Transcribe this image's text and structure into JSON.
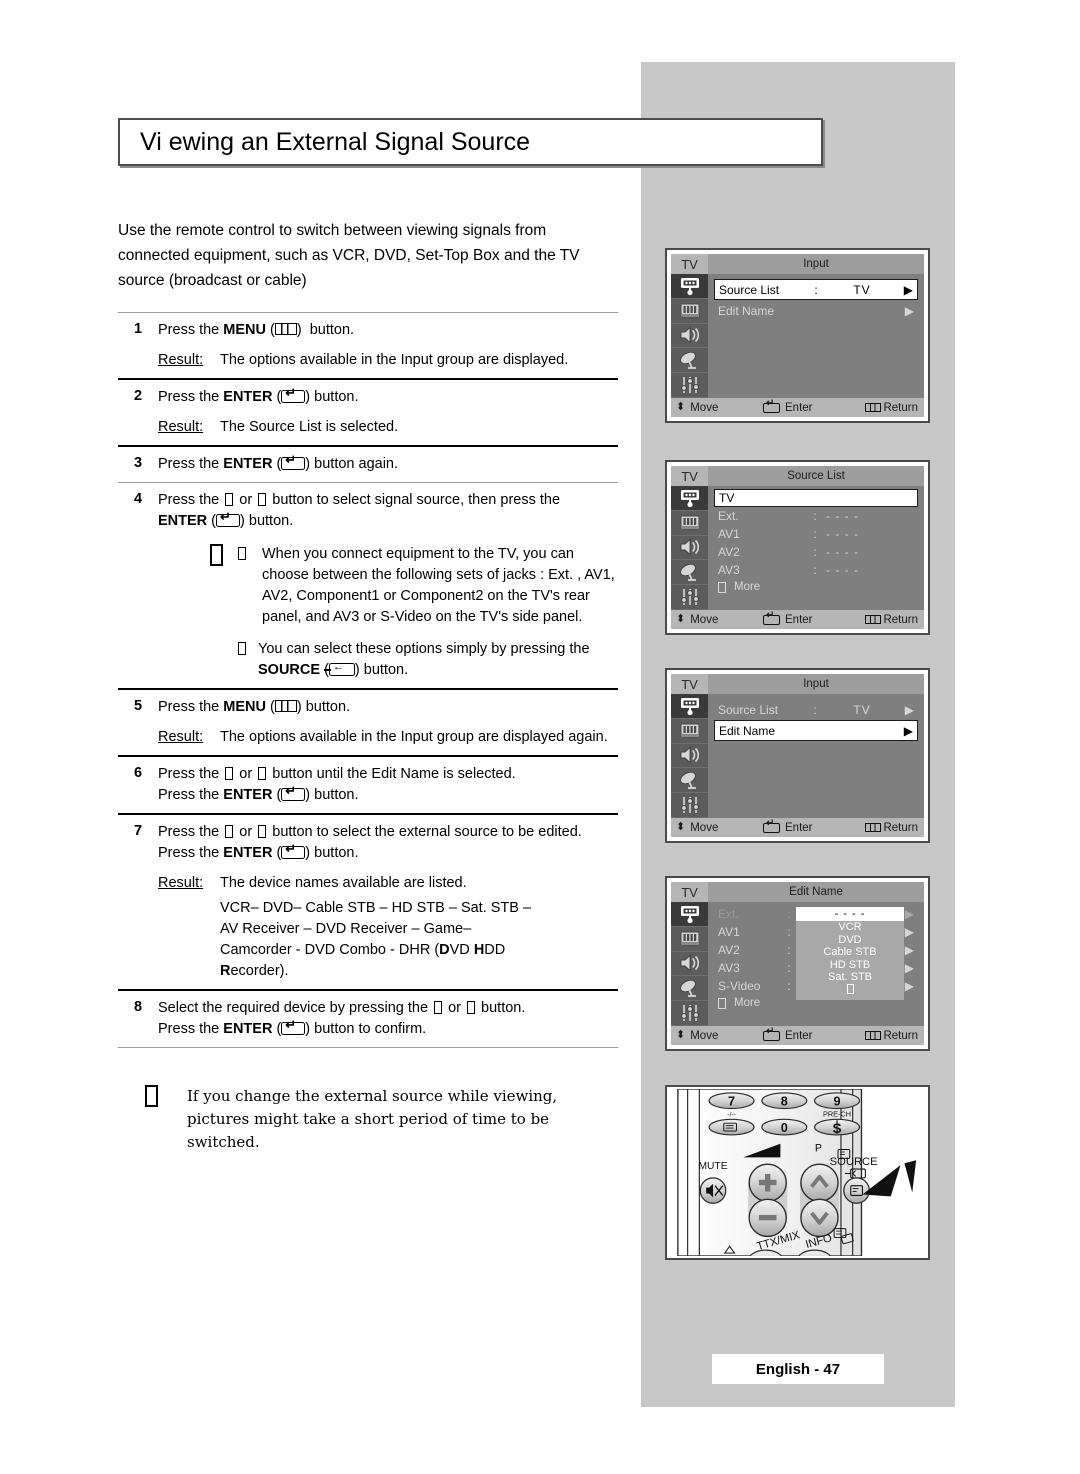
{
  "page": {
    "title": "Vi ewing an External Signal Source",
    "intro": "Use the remote control to switch between viewing signals from connected equipment, such as VCR, DVD, Set-Top Box and the TV source (broadcast or cable)",
    "footer": "English - 47"
  },
  "steps": [
    {
      "num": "1",
      "text_pre": "Press the ",
      "bold": "MENU",
      "icon": "menu-key-icon",
      "text_post": " button.",
      "result_label": "Result:",
      "result_text": "The options available in the Input   group are displayed."
    },
    {
      "num": "2",
      "text_pre": "Press the ",
      "bold": "ENTER",
      "icon": "enter-key-icon",
      "text_post": " button.",
      "result_label": "Result:",
      "result_text": "The Source List   is selected."
    },
    {
      "num": "3",
      "text_pre": "Press the ",
      "bold": "ENTER",
      "icon": "enter-key-icon",
      "text_post": " button again."
    },
    {
      "num": "4",
      "line1_a": "Press the ",
      "line1_b": " or ",
      "line1_c": " button to select signal source, then press the",
      "bold": "ENTER",
      "icon": "enter-key-icon",
      "line2_post": " button.",
      "notes": [
        "When you connect equipment to the TV, you can choose between the following sets of jacks :  Ext.  , AV1, AV2, Component1  or Component2  on the TV's rear panel, and AV3 or S-Video   on the TV's side panel.",
        "You can select these options simply by pressing the "
      ],
      "note2_bold": "SOURCE",
      "note2_icon": "source-key-icon",
      "note2_post": " button."
    },
    {
      "num": "5",
      "text_pre": "Press the ",
      "bold": "MENU",
      "icon": "menu-key-icon",
      "text_post": " button.",
      "result_label": "Result:",
      "result_text": "The options available in the Input   group are displayed again."
    },
    {
      "num": "6",
      "line1_a": "Press the ",
      "line1_b": " or ",
      "line1_c": " button until the Edit Name   is selected.",
      "line2_pre": "Press the ",
      "bold": "ENTER",
      "icon": "enter-key-icon",
      "line2_post": " button."
    },
    {
      "num": "7",
      "line1_a": "Press the ",
      "line1_b": " or ",
      "line1_c": " button to select the external source to be edited.",
      "line2_pre": "Press the ",
      "bold": "ENTER",
      "icon": "enter-key-icon",
      "line2_post": " button.",
      "result_label": "Result:",
      "result_text": "The device names available are listed.",
      "device_lines": [
        "VCR–  DVD– Cable STB   – HD STB –  Sat. STB     –",
        "AV Receiver     – DVD Receiver      – Game–",
        "Camcorder - DVD Combo - DHR        ("
      ],
      "device_bold_1": "D",
      "device_mid_1": "VD ",
      "device_bold_2": "H",
      "device_mid_2": "DD",
      "device_bold_3": "R",
      "device_tail": "ecorder)."
    },
    {
      "num": "8",
      "line1_a": "Select the required device by pressing the ",
      "line1_b": " or ",
      "line1_c": " button.",
      "line2_pre": "Press the ",
      "bold": "ENTER",
      "icon": "enter-key-icon",
      "line2_post": " button to confirm."
    }
  ],
  "bottom_note": "If you change the external source while viewing, pictures might take a short period of time to be switched.",
  "osd": {
    "footer": {
      "move": "Move",
      "enter": "Enter",
      "return": "Return"
    },
    "screens": [
      {
        "name": "input-menu-source-list-highlighted",
        "tv": "TV",
        "title": "Input",
        "rows": [
          {
            "label": "Source List",
            "colon": ":",
            "value": "TV",
            "arrow": "▶",
            "highlight": true
          },
          {
            "label": "Edit Name",
            "colon": "",
            "value": "",
            "arrow": "▶",
            "highlight": false
          }
        ]
      },
      {
        "name": "source-list-menu",
        "tv": "TV",
        "title": "Source List",
        "rows": [
          {
            "label": "TV",
            "colon": "",
            "value": "",
            "arrow": "",
            "highlight": true
          },
          {
            "label": "Ext.",
            "colon": ":",
            "value": "- - - -",
            "arrow": "",
            "highlight": false
          },
          {
            "label": "AV1",
            "colon": ":",
            "value": "- - - -",
            "arrow": "",
            "highlight": false
          },
          {
            "label": "AV2",
            "colon": ":",
            "value": "- - - -",
            "arrow": "",
            "highlight": false
          },
          {
            "label": "AV3",
            "colon": ":",
            "value": "- - - -",
            "arrow": "",
            "highlight": false
          }
        ],
        "more": "More"
      },
      {
        "name": "input-menu-edit-name-highlighted",
        "tv": "TV",
        "title": "Input",
        "rows": [
          {
            "label": "Source List",
            "colon": ":",
            "value": "TV",
            "arrow": "▶",
            "highlight": false
          },
          {
            "label": "Edit Name",
            "colon": "",
            "value": "",
            "arrow": "▶",
            "highlight": true
          }
        ]
      },
      {
        "name": "edit-name-menu",
        "tv": "TV",
        "title": "Edit Name",
        "rows": [
          {
            "label": "Ext.",
            "colon": ":",
            "value": "- - - -",
            "arrow": "▶",
            "dim": true
          },
          {
            "label": "AV1",
            "colon": ":",
            "value": "",
            "arrow": "▶"
          },
          {
            "label": "AV2",
            "colon": ":",
            "value": "",
            "arrow": "▶"
          },
          {
            "label": "AV3",
            "colon": ":",
            "value": "",
            "arrow": "▶"
          },
          {
            "label": "S-Video",
            "colon": ":",
            "value": "- - - -",
            "arrow": "▶"
          }
        ],
        "more": "More",
        "dropdown": {
          "selected": "- - - -",
          "items": [
            "VCR",
            "DVD",
            "Cable STB",
            "HD STB",
            "Sat. STB"
          ]
        }
      }
    ]
  },
  "remote": {
    "keys": {
      "seven": "7",
      "eight": "8",
      "nine": "9",
      "zero": "0",
      "dash_slash": "-/--",
      "pre_ch": "PRE-CH",
      "mute": "MUTE",
      "p": "P",
      "source": "SOURCE",
      "ttx_mix": "TTX/MIX",
      "info": "INFO",
      "plus": "+",
      "minus": "–"
    }
  }
}
